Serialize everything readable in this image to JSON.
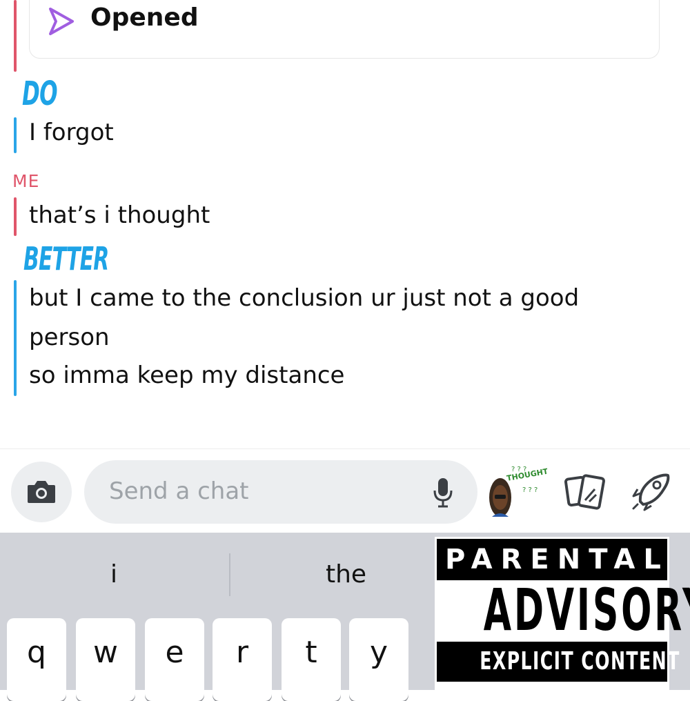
{
  "chat": {
    "status_label": "Opened",
    "messages": [
      {
        "sender": "DO",
        "text": "I forgot"
      },
      {
        "sender": "ME",
        "text": "that’s i thought"
      },
      {
        "sender": "BETTER",
        "lines": [
          "but I came to the conclusion ur just not a good",
          "person",
          "so imma keep my distance"
        ]
      }
    ]
  },
  "composer": {
    "placeholder": "Send a chat",
    "icons": [
      "camera-icon",
      "microphone-icon",
      "bitmoji-icon",
      "cards-icon",
      "rocket-icon"
    ],
    "bitmoji_text": "THOUGHTS?"
  },
  "keyboard": {
    "suggestions": [
      "i",
      "the"
    ],
    "keys": [
      "q",
      "w",
      "e",
      "r",
      "t",
      "y"
    ]
  },
  "advisory": {
    "top": "PARENTAL",
    "middle": "ADVISORY",
    "bottom": "EXPLICIT CONTENT"
  },
  "colors": {
    "me_accent": "#e0556a",
    "friend_accent": "#1ea3e6",
    "opened_icon": "#a05ee0"
  }
}
